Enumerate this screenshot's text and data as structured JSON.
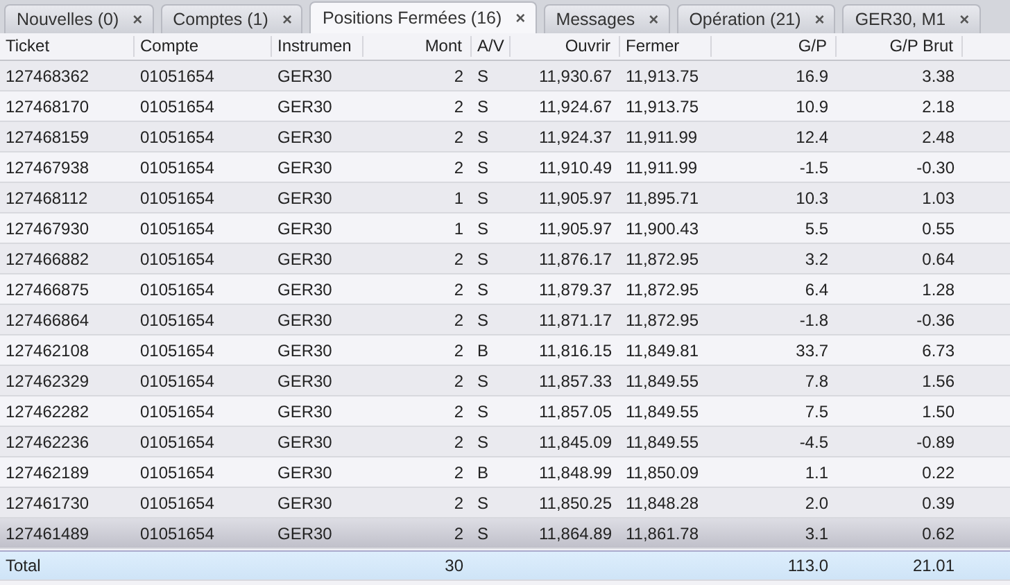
{
  "tabs": [
    {
      "label": "Nouvelles (0)",
      "close": "×",
      "selected": false
    },
    {
      "label": "Comptes (1)",
      "close": "×",
      "selected": false
    },
    {
      "label": "Positions Fermées (16)",
      "close": "×",
      "selected": true
    },
    {
      "label": "Messages",
      "close": "×",
      "selected": false
    },
    {
      "label": "Opération (21)",
      "close": "×",
      "selected": false
    },
    {
      "label": "GER30, M1",
      "close": "×",
      "selected": false
    }
  ],
  "table": {
    "columns": [
      "Ticket",
      "Compte",
      "Instrumen",
      "Mont",
      "A/V",
      "Ouvrir",
      "Fermer",
      "G/P",
      "G/P Brut"
    ],
    "rows": [
      {
        "cells": [
          "127468362",
          "01051654",
          "GER30",
          "2",
          "S",
          "11,930.67",
          "11,913.75",
          "16.9",
          "3.38"
        ],
        "selected": false
      },
      {
        "cells": [
          "127468170",
          "01051654",
          "GER30",
          "2",
          "S",
          "11,924.67",
          "11,913.75",
          "10.9",
          "2.18"
        ],
        "selected": false
      },
      {
        "cells": [
          "127468159",
          "01051654",
          "GER30",
          "2",
          "S",
          "11,924.37",
          "11,911.99",
          "12.4",
          "2.48"
        ],
        "selected": false
      },
      {
        "cells": [
          "127467938",
          "01051654",
          "GER30",
          "2",
          "S",
          "11,910.49",
          "11,911.99",
          "-1.5",
          "-0.30"
        ],
        "selected": false
      },
      {
        "cells": [
          "127468112",
          "01051654",
          "GER30",
          "1",
          "S",
          "11,905.97",
          "11,895.71",
          "10.3",
          "1.03"
        ],
        "selected": false
      },
      {
        "cells": [
          "127467930",
          "01051654",
          "GER30",
          "1",
          "S",
          "11,905.97",
          "11,900.43",
          "5.5",
          "0.55"
        ],
        "selected": false
      },
      {
        "cells": [
          "127466882",
          "01051654",
          "GER30",
          "2",
          "S",
          "11,876.17",
          "11,872.95",
          "3.2",
          "0.64"
        ],
        "selected": false
      },
      {
        "cells": [
          "127466875",
          "01051654",
          "GER30",
          "2",
          "S",
          "11,879.37",
          "11,872.95",
          "6.4",
          "1.28"
        ],
        "selected": false
      },
      {
        "cells": [
          "127466864",
          "01051654",
          "GER30",
          "2",
          "S",
          "11,871.17",
          "11,872.95",
          "-1.8",
          "-0.36"
        ],
        "selected": false
      },
      {
        "cells": [
          "127462108",
          "01051654",
          "GER30",
          "2",
          "B",
          "11,816.15",
          "11,849.81",
          "33.7",
          "6.73"
        ],
        "selected": false
      },
      {
        "cells": [
          "127462329",
          "01051654",
          "GER30",
          "2",
          "S",
          "11,857.33",
          "11,849.55",
          "7.8",
          "1.56"
        ],
        "selected": false
      },
      {
        "cells": [
          "127462282",
          "01051654",
          "GER30",
          "2",
          "S",
          "11,857.05",
          "11,849.55",
          "7.5",
          "1.50"
        ],
        "selected": false
      },
      {
        "cells": [
          "127462236",
          "01051654",
          "GER30",
          "2",
          "S",
          "11,845.09",
          "11,849.55",
          "-4.5",
          "-0.89"
        ],
        "selected": false
      },
      {
        "cells": [
          "127462189",
          "01051654",
          "GER30",
          "2",
          "B",
          "11,848.99",
          "11,850.09",
          "1.1",
          "0.22"
        ],
        "selected": false
      },
      {
        "cells": [
          "127461730",
          "01051654",
          "GER30",
          "2",
          "S",
          "11,850.25",
          "11,848.28",
          "2.0",
          "0.39"
        ],
        "selected": false
      },
      {
        "cells": [
          "127461489",
          "01051654",
          "GER30",
          "2",
          "S",
          "11,864.89",
          "11,861.78",
          "3.1",
          "0.62"
        ],
        "selected": true
      }
    ],
    "total": {
      "label": "Total",
      "mont": "30",
      "gp": "113.0",
      "gp_brut": "21.01"
    }
  }
}
